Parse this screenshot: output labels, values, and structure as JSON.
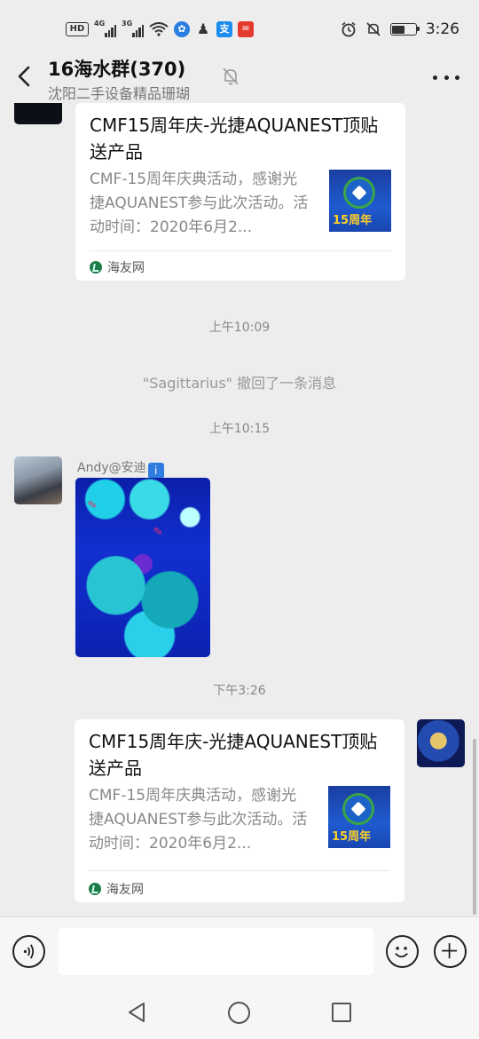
{
  "status_bar": {
    "hd": "HD",
    "sim1_net": "4G",
    "sim2_net": "3G",
    "time": "3:26",
    "battery_level": 0.55
  },
  "header": {
    "title": "16海水群(370)",
    "subtitle": "沈阳二手设备精品珊瑚"
  },
  "messages": {
    "card1": {
      "title": "CMF15周年庆-光捷AQUANEST顶贴送产品",
      "desc": "CMF-15周年庆典活动，感谢光捷AQUANEST参与此次活动。活动时间：2020年6月2...",
      "thumb_text": "15周年",
      "source": "海友网"
    },
    "time1": "上午10:09",
    "recall_notice": "\"Sagittarius\" 撤回了一条消息",
    "time2": "上午10:15",
    "andy": {
      "nickname": "Andy@安迪",
      "badge": "i"
    },
    "time3": "下午3:26",
    "card2": {
      "title": "CMF15周年庆-光捷AQUANEST顶贴送产品",
      "desc": "CMF-15周年庆典活动，感谢光捷AQUANEST参与此次活动。活动时间：2020年6月2...",
      "thumb_text": "15周年",
      "source": "海友网"
    }
  },
  "icons": {
    "back": "back-arrow-icon",
    "mute": "bell-off-icon",
    "more": "more-dots-icon",
    "voice": "voice-icon",
    "emoji": "emoji-icon",
    "plus": "plus-icon"
  },
  "colors": {
    "background": "#ededed",
    "card": "#ffffff",
    "badge": "#2f7de1"
  }
}
